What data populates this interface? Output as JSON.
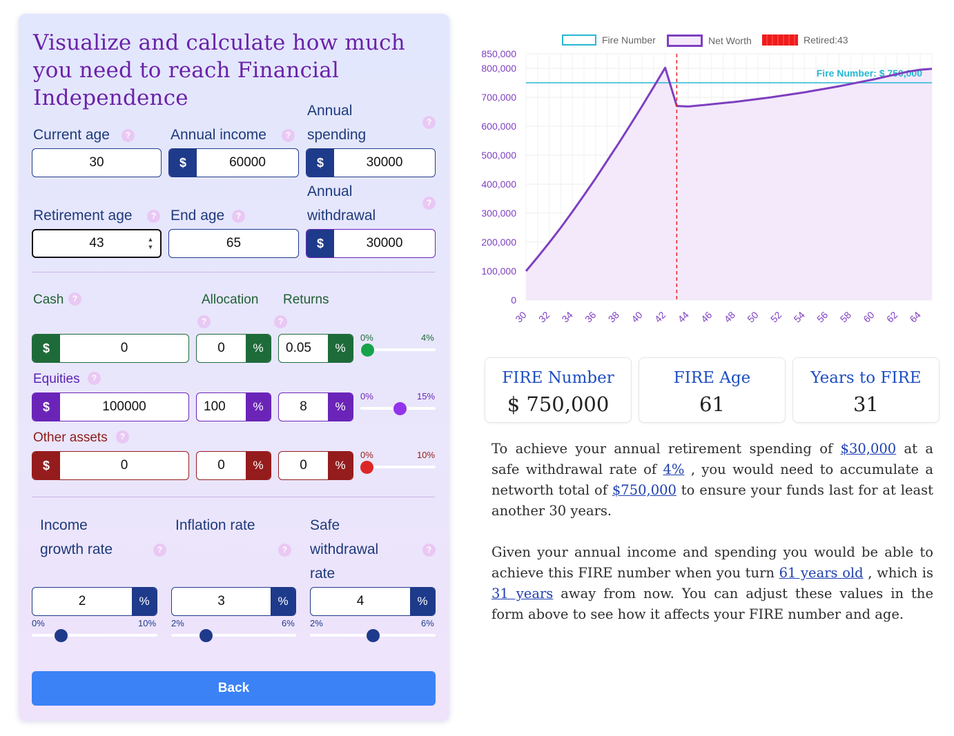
{
  "form": {
    "title": "Visualize and calculate how much you need to reach Financial Independence",
    "current_age": {
      "label": "Current age",
      "value": "30"
    },
    "annual_income": {
      "label": "Annual income",
      "prefix": "$",
      "value": "60000"
    },
    "annual_spending": {
      "label_line1": "Annual",
      "label_line2": "spending",
      "prefix": "$",
      "value": "30000"
    },
    "retirement_age": {
      "label": "Retirement age",
      "value": "43"
    },
    "end_age": {
      "label": "End age",
      "value": "65"
    },
    "annual_withdrawal": {
      "label_line1": "Annual",
      "label_line2": "withdrawal",
      "prefix": "$",
      "value": "30000"
    },
    "allocation_header": "Allocation",
    "returns_header": "Returns",
    "assets": [
      {
        "name": "Cash",
        "prefix": "$",
        "amount": "0",
        "allocation": "0",
        "returns": "0.05",
        "suffix": "%",
        "range_min": "0%",
        "range_max": "4%",
        "level": 0.0125
      },
      {
        "name": "Equities",
        "prefix": "$",
        "amount": "100000",
        "allocation": "100",
        "returns": "8",
        "suffix": "%",
        "range_min": "0%",
        "range_max": "15%",
        "level": 0.533
      },
      {
        "name": "Other assets",
        "prefix": "$",
        "amount": "0",
        "allocation": "0",
        "returns": "0",
        "suffix": "%",
        "range_min": "0%",
        "range_max": "10%",
        "level": 0.0
      }
    ],
    "rates": [
      {
        "label_lines": [
          "Income",
          "growth rate"
        ],
        "value": "2",
        "suffix": "%",
        "range_min": "0%",
        "range_max": "10%",
        "level": 0.2
      },
      {
        "label_lines": [
          "Inflation rate"
        ],
        "value": "3",
        "suffix": "%",
        "range_min": "2%",
        "range_max": "6%",
        "level": 0.25
      },
      {
        "label_lines": [
          "Safe",
          "withdrawal",
          "rate"
        ],
        "value": "4",
        "suffix": "%",
        "range_min": "2%",
        "range_max": "6%",
        "level": 0.5
      }
    ],
    "help_glyph": "?",
    "back_label": "Back"
  },
  "chart_data": {
    "type": "line",
    "legend": [
      "Fire Number",
      "Net Worth",
      "Retired:43"
    ],
    "fire_label": "Fire Number: $ 750,000",
    "fire_number": 750000,
    "retired_age": 43,
    "x": [
      30,
      31,
      32,
      33,
      34,
      35,
      36,
      37,
      38,
      39,
      40,
      41,
      42,
      43,
      44,
      45,
      46,
      47,
      48,
      49,
      50,
      51,
      52,
      53,
      54,
      55,
      56,
      57,
      58,
      59,
      60,
      61,
      62,
      63,
      64,
      65
    ],
    "series": [
      {
        "name": "Net Worth",
        "values": [
          100000,
          148000,
          198000,
          250000,
          305000,
          362000,
          420000,
          481000,
          542000,
          605000,
          669000,
          735000,
          802000,
          670000,
          668000,
          672000,
          676000,
          680000,
          684000,
          689000,
          694000,
          699000,
          705000,
          711000,
          717000,
          724000,
          731000,
          738000,
          746000,
          754000,
          762000,
          771000,
          780000,
          789000,
          795000,
          798000
        ]
      }
    ],
    "ylim": [
      0,
      850000
    ],
    "yticks": [
      850000,
      800000,
      700000,
      600000,
      500000,
      400000,
      300000,
      200000,
      100000,
      0
    ],
    "ytick_labels": [
      "850,000",
      "800,000",
      "700,000",
      "600,000",
      "500,000",
      "400,000",
      "300,000",
      "200,000",
      "100,000",
      "0"
    ],
    "xticks": [
      30,
      32,
      34,
      36,
      38,
      40,
      42,
      44,
      46,
      48,
      50,
      52,
      54,
      56,
      58,
      60,
      62,
      64
    ],
    "colors": {
      "fire": "#26b7d3",
      "networth": "#7e3fc0",
      "retired": "#ee1c1c",
      "fill": "#f3e9fb"
    }
  },
  "stats": [
    {
      "title": "FIRE Number",
      "value": "$ 750,000"
    },
    {
      "title": "FIRE Age",
      "value": "61"
    },
    {
      "title": "Years to FIRE",
      "value": "31"
    }
  ],
  "summary": {
    "p1": [
      "To achieve your annual retirement spending of ",
      "$30,000",
      " at a safe withdrawal rate of ",
      "4%",
      " , you would need to accumulate a networth total of ",
      "$750,000",
      " to ensure your funds last for at least another 30 years."
    ],
    "p2": [
      "Given your annual income and spending you would be able to achieve this FIRE number when you turn ",
      "61 years old",
      " , which is ",
      "31 years",
      " away from now. You can adjust these values in the form above to see how it affects your FIRE number and age."
    ]
  }
}
